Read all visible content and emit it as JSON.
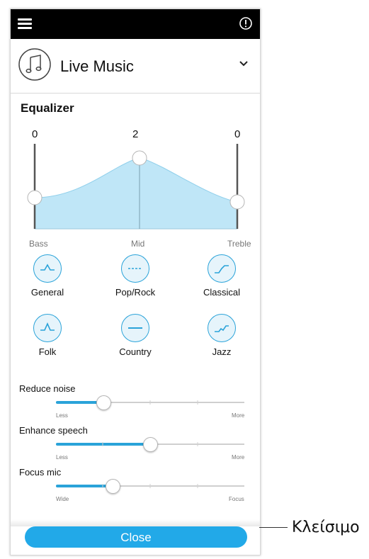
{
  "header": {
    "menu_icon": "hamburger-menu-icon",
    "info_icon": "info-icon"
  },
  "program": {
    "icon": "music-note-icon",
    "name": "Live Music",
    "dropdown_icon": "chevron-down-icon"
  },
  "equalizer": {
    "title": "Equalizer",
    "bands": [
      {
        "label": "Bass",
        "value": "0"
      },
      {
        "label": "Mid",
        "value": "2"
      },
      {
        "label": "Treble",
        "value": "0"
      }
    ],
    "fill_color": "#bfe6f7",
    "accent_color": "#2aa3d9"
  },
  "presets": [
    {
      "label": "General",
      "icon": "general-curve-icon"
    },
    {
      "label": "Pop/Rock",
      "icon": "pop-rock-curve-icon"
    },
    {
      "label": "Classical",
      "icon": "classical-curve-icon"
    },
    {
      "label": "Folk",
      "icon": "folk-curve-icon"
    },
    {
      "label": "Country",
      "icon": "country-curve-icon"
    },
    {
      "label": "Jazz",
      "icon": "jazz-curve-icon"
    }
  ],
  "sliders": [
    {
      "title": "Reduce noise",
      "min_label": "Less",
      "max_label": "More",
      "level": 0.25
    },
    {
      "title": "Enhance speech",
      "min_label": "Less",
      "max_label": "More",
      "level": 0.5
    },
    {
      "title": "Focus mic",
      "min_label": "Wide",
      "max_label": "Focus",
      "level": 0.3
    }
  ],
  "footer": {
    "close_label": "Close",
    "callout": "Κλείσιμο",
    "button_color": "#22a9e8"
  }
}
